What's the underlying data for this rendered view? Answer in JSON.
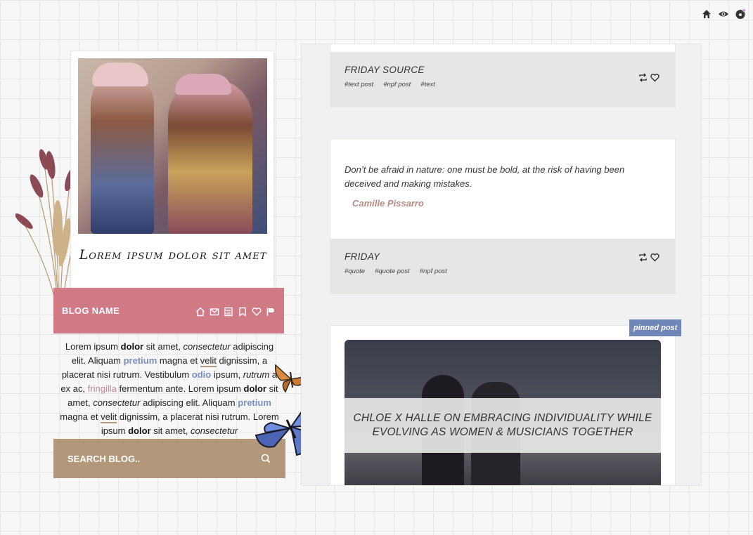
{
  "topbar": {
    "icons": [
      "home-icon",
      "eye-icon",
      "palette-icon"
    ]
  },
  "sidebar": {
    "title": "Lorem ipsum dolor sit amet",
    "blog_name": "BLOG NAME",
    "nav_icons": [
      "home-icon",
      "mail-icon",
      "archive-icon",
      "bookmark-icon",
      "heart-icon",
      "flag-icon"
    ],
    "description": {
      "s1": "Lorem ipsum ",
      "s2": "dolor",
      "s3": " sit amet, ",
      "s4": "consectetur",
      "s5": " adipiscing elit. Aliquam ",
      "s6": "pretium",
      "s7": " magna et ",
      "s8": "velit",
      "s9": " dignissim, a placerat nisi rutrum. Vestibulum ",
      "s10": "odio",
      "s11": " ipsum, ",
      "s12": "rutrum",
      "s13": " a ex ac, ",
      "s14": "fringilla",
      "s15": " fermentum ante. Lorem ipsum ",
      "s16": "dolor",
      "s17": " sit amet, ",
      "s18": "consectetur",
      "s19": " adipiscing elit. Aliquam ",
      "s20": "pretium",
      "s21": " magna et ",
      "s22": "velit",
      "s23": " dignissim, a placerat nisi rutrum. Lorem ipsum ",
      "s24": "dolor",
      "s25": " sit amet, ",
      "s26": "consectetur"
    },
    "search_placeholder": "SEARCH BLOG.."
  },
  "posts": [
    {
      "title": "FRIDAY  SOURCE",
      "tags": [
        "#text post",
        "#npf post",
        "#text"
      ]
    },
    {
      "quote": "Don’t be afraid in nature: one must be bold, at the risk of having been deceived and making mistakes.",
      "source": "Camille Pissarro",
      "title": "FRIDAY",
      "tags": [
        "#quote",
        "#quote post",
        "#npf post"
      ]
    },
    {
      "badge": "pinned post",
      "headline": "CHLOE X HALLE ON EMBRACING INDIVIDUALITY WHILE EVOLVING AS WOMEN & MUSICIANS TOGETHER"
    }
  ],
  "colors": {
    "blogbar": "#d07a86",
    "search": "#b3977a",
    "pinned": "#6f86b8",
    "accent_blue": "#7b8fc0",
    "quote_source": "#b88a84"
  }
}
